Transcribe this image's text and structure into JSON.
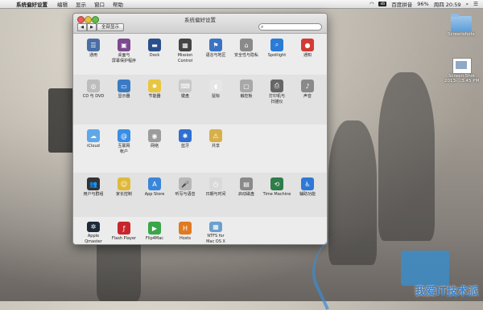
{
  "menubar": {
    "apple": "",
    "app": "系统偏好设置",
    "menus": [
      "编辑",
      "显示",
      "窗口",
      "帮助"
    ],
    "input_badge": "sb",
    "input_method": "百度拼音",
    "battery": "96%",
    "clock": "周四 20:59"
  },
  "window": {
    "title": "系统偏好设置",
    "back": "◀",
    "forward": "▶",
    "show_all": "全部显示",
    "search_placeholder": ""
  },
  "sections": [
    {
      "items": [
        {
          "label": "通用",
          "icon": "general-icon",
          "color": "#4a6fa5",
          "glyph": "☰"
        },
        {
          "label": "桌面与\n屏幕保护程序",
          "icon": "desktop-screensaver-icon",
          "color": "#7c4a8f",
          "glyph": "▣"
        },
        {
          "label": "Dock",
          "icon": "dock-icon",
          "color": "#2b4f8c",
          "glyph": "▬"
        },
        {
          "label": "Mission\nControl",
          "icon": "mission-control-icon",
          "color": "#444",
          "glyph": "▦"
        },
        {
          "label": "语言与地区",
          "icon": "language-region-icon",
          "color": "#3a73c4",
          "glyph": "⚑"
        },
        {
          "label": "安全性与隐私",
          "icon": "security-privacy-icon",
          "color": "#8a8a8a",
          "glyph": "⌂"
        },
        {
          "label": "Spotlight",
          "icon": "spotlight-icon",
          "color": "#2b7bd6",
          "glyph": "⌕"
        },
        {
          "label": "通知",
          "icon": "notifications-icon",
          "color": "#d23b34",
          "glyph": "●"
        }
      ]
    },
    {
      "items": [
        {
          "label": "CD 与 DVD",
          "icon": "cd-dvd-icon",
          "color": "#bdbdbd",
          "glyph": "◎"
        },
        {
          "label": "显示器",
          "icon": "displays-icon",
          "color": "#3b7bc4",
          "glyph": "▭"
        },
        {
          "label": "节能器",
          "icon": "energy-saver-icon",
          "color": "#e8c640",
          "glyph": "✹"
        },
        {
          "label": "键盘",
          "icon": "keyboard-icon",
          "color": "#c9c9c9",
          "glyph": "⌨"
        },
        {
          "label": "鼠标",
          "icon": "mouse-icon",
          "color": "#e6e6e6",
          "glyph": "◖"
        },
        {
          "label": "触控板",
          "icon": "trackpad-icon",
          "color": "#a8a8a8",
          "glyph": "▢"
        },
        {
          "label": "打印机与\n扫描仪",
          "icon": "printers-scanners-icon",
          "color": "#666",
          "glyph": "⎙"
        },
        {
          "label": "声音",
          "icon": "sound-icon",
          "color": "#8a8a8a",
          "glyph": "♪"
        }
      ]
    },
    {
      "items": [
        {
          "label": "iCloud",
          "icon": "icloud-icon",
          "color": "#5fa8e8",
          "glyph": "☁"
        },
        {
          "label": "互联网\n帐户",
          "icon": "internet-accounts-icon",
          "color": "#3a8ee6",
          "glyph": "@"
        },
        {
          "label": "网络",
          "icon": "network-icon",
          "color": "#9c9c9c",
          "glyph": "◉"
        },
        {
          "label": "蓝牙",
          "icon": "bluetooth-icon",
          "color": "#2f6fd0",
          "glyph": "✱"
        },
        {
          "label": "共享",
          "icon": "sharing-icon",
          "color": "#d8b04a",
          "glyph": "⚠"
        }
      ]
    },
    {
      "items": [
        {
          "label": "用户与群组",
          "icon": "users-groups-icon",
          "color": "#333",
          "glyph": "👥"
        },
        {
          "label": "家长控制",
          "icon": "parental-controls-icon",
          "color": "#e0b93a",
          "glyph": "☺"
        },
        {
          "label": "App Store",
          "icon": "app-store-icon",
          "color": "#3a86d8",
          "glyph": "A"
        },
        {
          "label": "听写与语音",
          "icon": "dictation-speech-icon",
          "color": "#b8b8b8",
          "glyph": "🎤"
        },
        {
          "label": "日期与时间",
          "icon": "date-time-icon",
          "color": "#d9d9d9",
          "glyph": "◷"
        },
        {
          "label": "启动磁盘",
          "icon": "startup-disk-icon",
          "color": "#8a8a8a",
          "glyph": "▤"
        },
        {
          "label": "Time Machine",
          "icon": "time-machine-icon",
          "color": "#2f7d4a",
          "glyph": "⟲"
        },
        {
          "label": "辅助功能",
          "icon": "accessibility-icon",
          "color": "#2f78d6",
          "glyph": "♿"
        }
      ]
    },
    {
      "items": [
        {
          "label": "Apple\nQmaster",
          "icon": "apple-qmaster-icon",
          "color": "#1d2a3a",
          "glyph": "✲"
        },
        {
          "label": "Flash Player",
          "icon": "flash-player-icon",
          "color": "#c8262c",
          "glyph": "ƒ"
        },
        {
          "label": "Flip4Mac",
          "icon": "flip4mac-icon",
          "color": "#3aa64a",
          "glyph": "▶"
        },
        {
          "label": "Hosts",
          "icon": "hosts-icon",
          "color": "#e07a22",
          "glyph": "H"
        },
        {
          "label": "NTFS for\nMac OS X",
          "icon": "ntfs-icon",
          "color": "#6c9fcf",
          "glyph": "▦"
        }
      ]
    }
  ],
  "desktop": {
    "folder_label": "Screenshots",
    "shot_label": "Screen Shot\n2013-...3.45 PM"
  },
  "watermark": {
    "text": "我爱IT技术派",
    "url": "52ssspai.com"
  }
}
